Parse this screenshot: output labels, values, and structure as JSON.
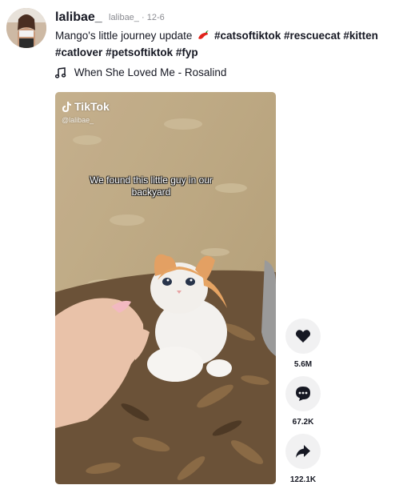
{
  "author": {
    "username": "lalibae_",
    "handle": "lalibae_",
    "date": "12-6"
  },
  "caption": {
    "text": "Mango's little journey update",
    "emoji": "chili-pepper",
    "hashtags_line1": [
      "#catsoftiktok",
      "#rescuecat",
      "#kitten"
    ],
    "hashtags_line2": [
      "#catlover",
      "#petsoftiktok",
      "#fyp"
    ]
  },
  "music": {
    "icon": "music-note-icon",
    "title": "When She Loved Me - Rosalind"
  },
  "video": {
    "logo_text": "TikTok",
    "watermark_handle": "@lalibae_",
    "overlay_text": "We found this little guy in our backyard"
  },
  "actions": {
    "likes": "5.6M",
    "comments": "67.2K",
    "shares": "122.1K"
  },
  "colors": {
    "accent": "#fe2c55",
    "text": "#161823",
    "muted": "#8a8b91",
    "button_bg": "#f1f1f2"
  }
}
